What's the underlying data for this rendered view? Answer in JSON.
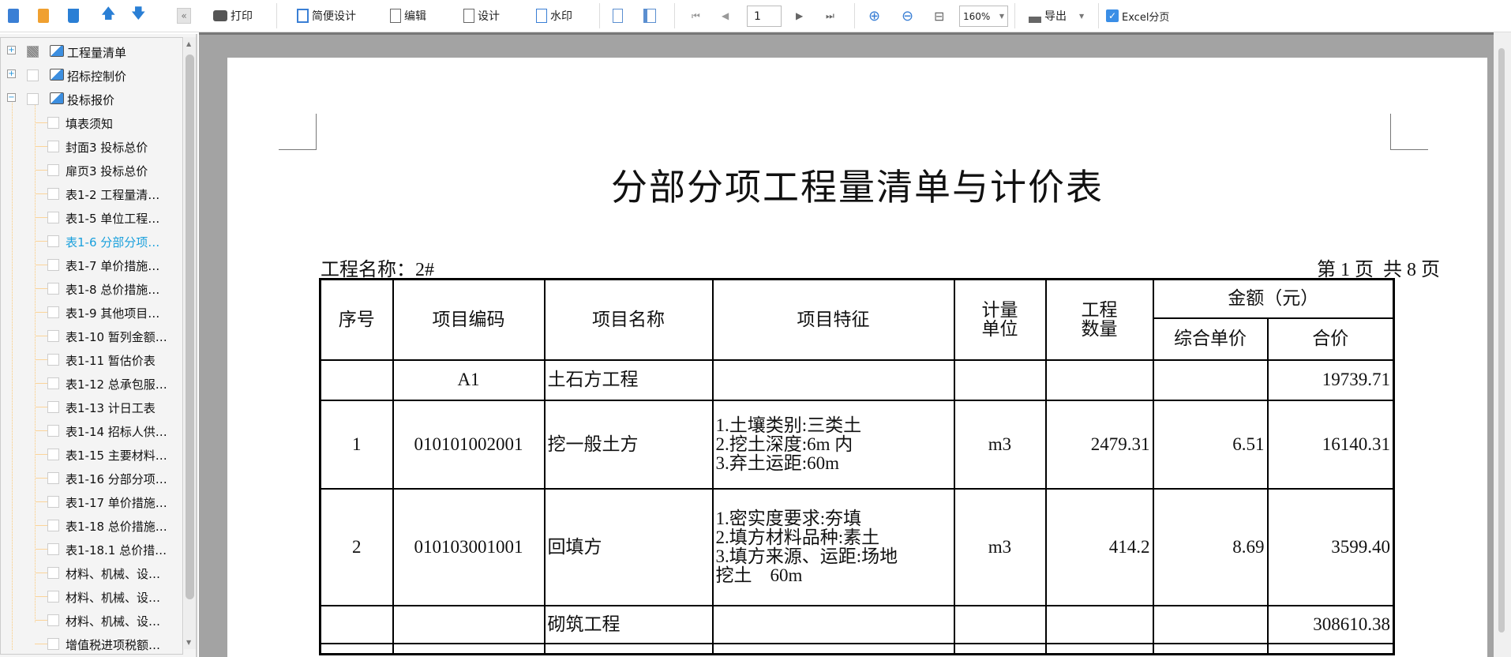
{
  "toolbar": {
    "print": "打印",
    "simple_design": "简便设计",
    "edit": "编辑",
    "design": "设计",
    "watermark": "水印",
    "page_number": "1",
    "zoom": "160%",
    "export": "导出",
    "excel_paging": "Excel分页",
    "excel_paging_checked": true
  },
  "tree": {
    "roots": [
      {
        "label": "工程量清单",
        "expander": "+"
      },
      {
        "label": "招标控制价",
        "expander": "+"
      },
      {
        "label": "投标报价",
        "expander": "−"
      }
    ],
    "children": [
      "填表须知",
      "封面3 投标总价",
      "扉页3 投标总价",
      "表1-2 工程量清…",
      "表1-5 单位工程…",
      "表1-6 分部分项…",
      "表1-7 单价措施…",
      "表1-8 总价措施…",
      "表1-9 其他项目…",
      "表1-10 暂列金额…",
      "表1-11 暂估价表",
      "表1-12 总承包服…",
      "表1-13 计日工表",
      "表1-14 招标人供…",
      "表1-15 主要材料…",
      "表1-16 分部分项…",
      "表1-17 单价措施…",
      "表1-18 总价措施…",
      "表1-18.1 总价措…",
      "材料、机械、设…",
      "材料、机械、设…",
      "材料、机械、设…",
      "增值税进项税额…"
    ],
    "active_index": 5,
    "active_color": "#1aa0dc"
  },
  "report": {
    "title": "分部分项工程量清单与计价表",
    "project_name": "工程名称：2#",
    "page_info": "第 1 页  共 8 页",
    "headers": {
      "seq": "序号",
      "code": "项目编码",
      "name": "项目名称",
      "feature": "项目特征",
      "unit": "计量单位",
      "qty": "工程数量",
      "amount": "金额（元）",
      "unit_price": "综合单价",
      "total": "合价"
    },
    "rows": [
      {
        "seq": "",
        "code": "A1",
        "name": "土石方工程",
        "feature": "",
        "unit": "",
        "qty": "",
        "unit_price": "",
        "total": "19739.71"
      },
      {
        "seq": "1",
        "code": "010101002001",
        "name": "挖一般土方",
        "feature": "1.土壤类别:三类土\n2.挖土深度:6m 内\n3.弃土运距:60m",
        "unit": "m3",
        "qty": "2479.31",
        "unit_price": "6.51",
        "total": "16140.31"
      },
      {
        "seq": "2",
        "code": "010103001001",
        "name": "回填方",
        "feature": "1.密实度要求:夯填\n2.填方材料品种:素土\n3.填方来源、运距:场地\n挖土    60m",
        "unit": "m3",
        "qty": "414.2",
        "unit_price": "8.69",
        "total": "3599.40"
      },
      {
        "seq": "",
        "code": "",
        "name": "砌筑工程",
        "feature": "",
        "unit": "",
        "qty": "",
        "unit_price": "",
        "total": "308610.38"
      }
    ]
  }
}
